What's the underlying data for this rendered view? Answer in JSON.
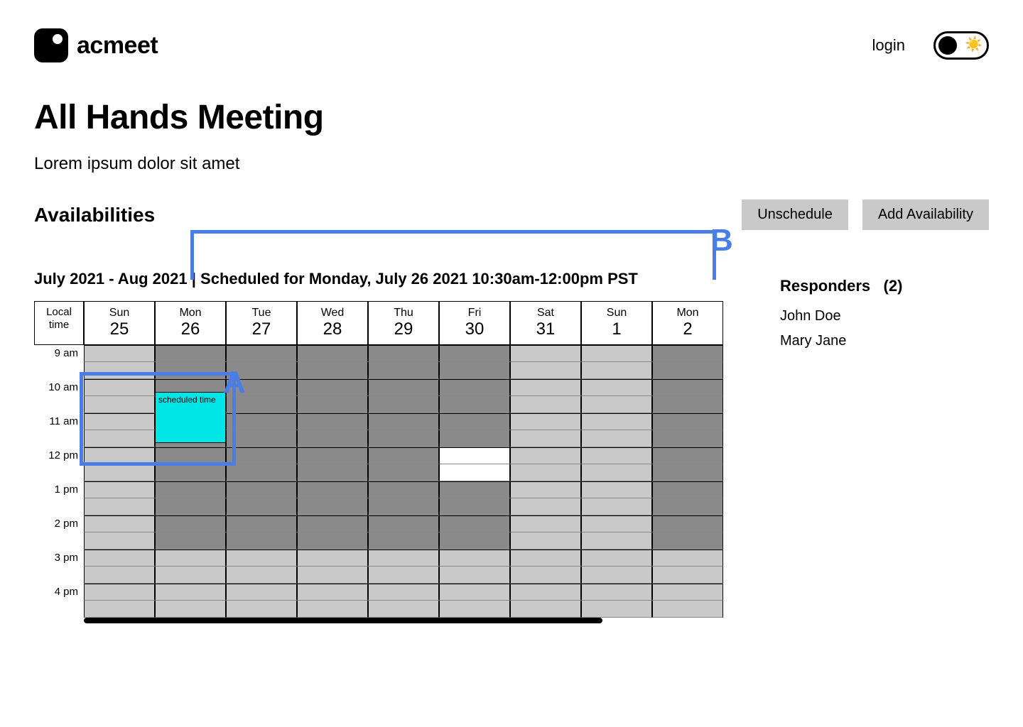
{
  "header": {
    "brand": "acmeet",
    "login": "login"
  },
  "meeting": {
    "title": "All Hands Meeting",
    "subtitle": "Lorem ipsum dolor sit amet",
    "section_label": "Availabilities",
    "unschedule_btn": "Unschedule",
    "add_btn": "Add Availability",
    "date_range": "July 2021 - Aug  2021",
    "scheduled_text": "Scheduled for Monday, July 26 2021 10:30am-12:00pm PST"
  },
  "grid": {
    "time_header": "Local time",
    "days": [
      {
        "dow": "Sun",
        "num": "25"
      },
      {
        "dow": "Mon",
        "num": "26"
      },
      {
        "dow": "Tue",
        "num": "27"
      },
      {
        "dow": "Wed",
        "num": "28"
      },
      {
        "dow": "Thu",
        "num": "29"
      },
      {
        "dow": "Fri",
        "num": "30"
      },
      {
        "dow": "Sat",
        "num": "31"
      },
      {
        "dow": "Sun",
        "num": "1"
      },
      {
        "dow": "Mon",
        "num": "2"
      }
    ],
    "hours": [
      "9 am",
      "10 am",
      "11 am",
      "12 pm",
      "1 pm",
      "2 pm",
      "3 pm",
      "4 pm"
    ],
    "scheduled_block_label": "scheduled time"
  },
  "responders": {
    "title": "Responders",
    "count": "(2)",
    "people": [
      "John Doe",
      "Mary Jane"
    ]
  },
  "annotations": {
    "a": "A",
    "b": "B"
  }
}
